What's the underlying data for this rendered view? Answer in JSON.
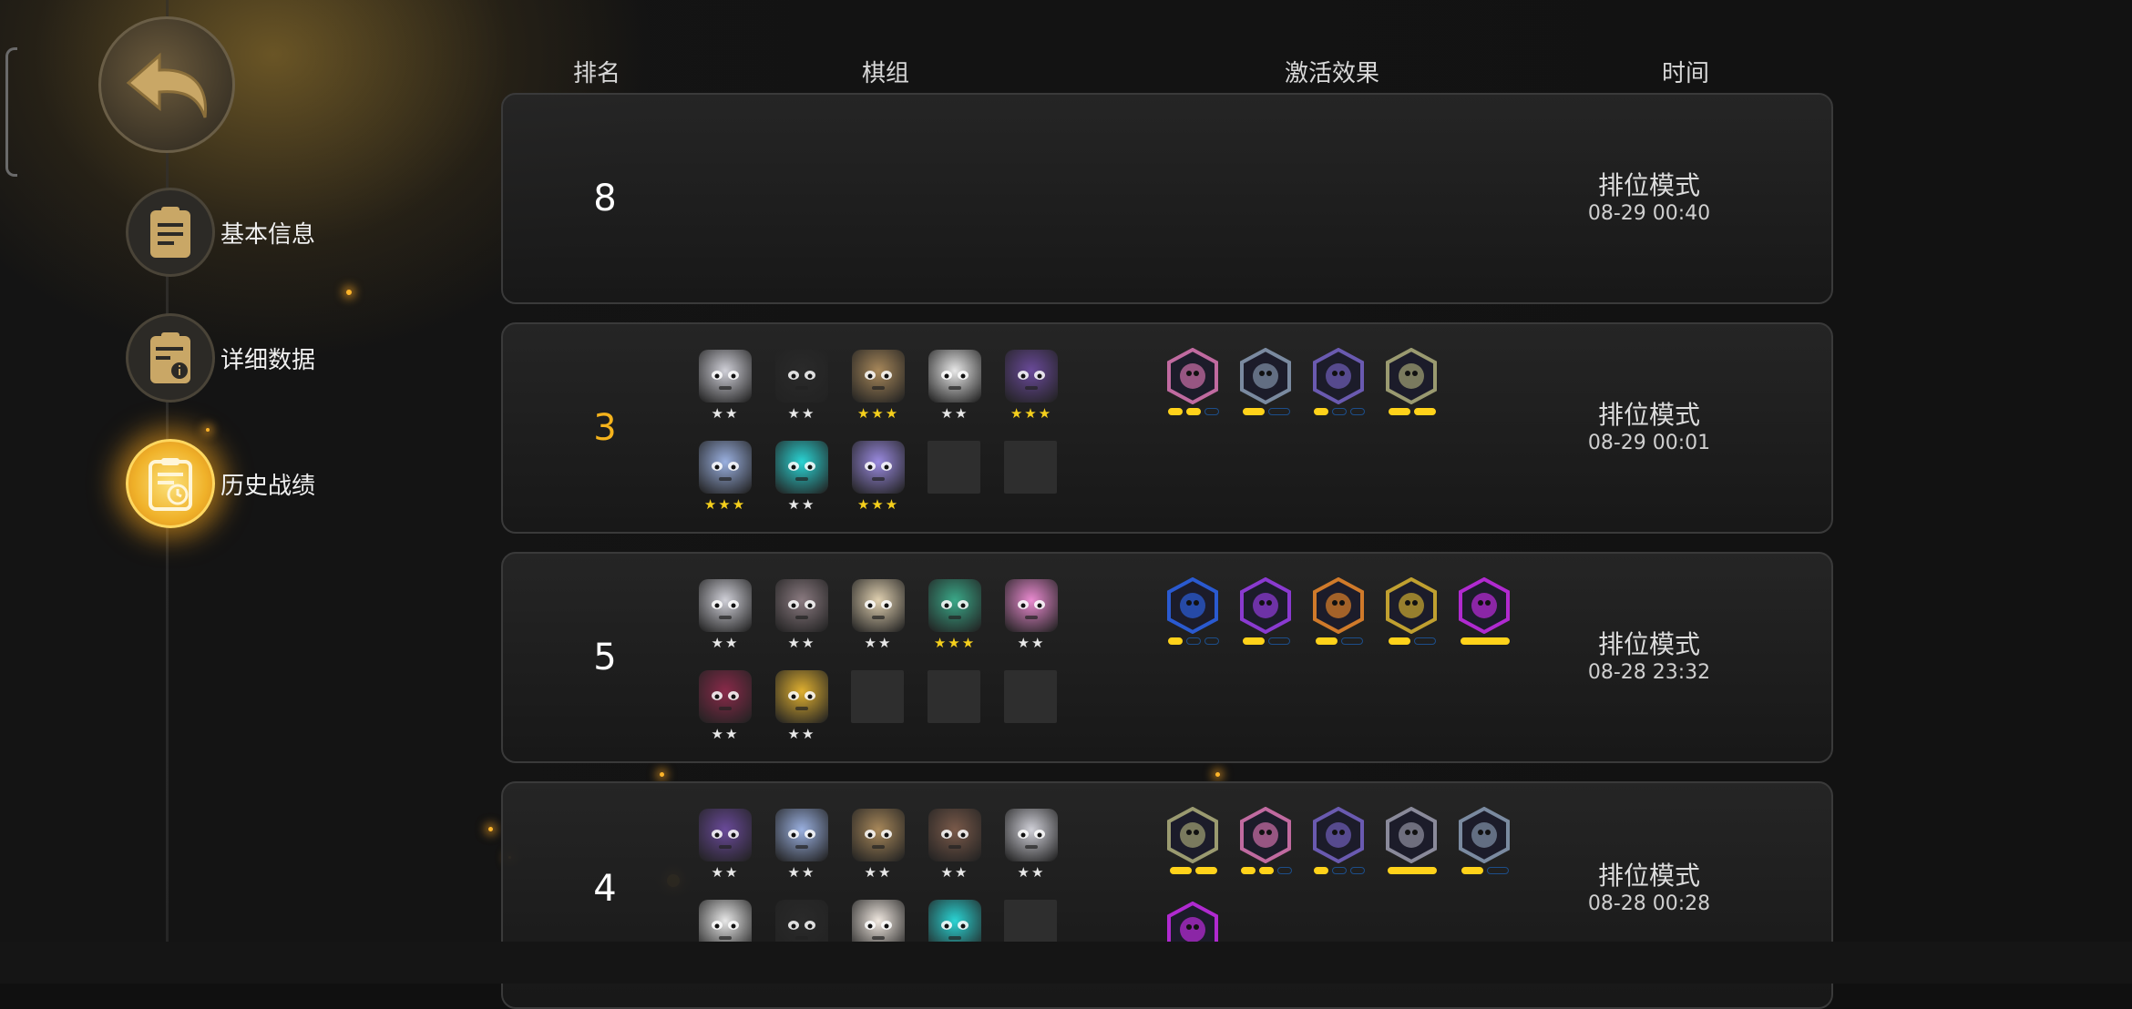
{
  "nav": {
    "back_label": "",
    "items": [
      {
        "label": "基本信息",
        "active": false
      },
      {
        "label": "详细数据",
        "active": false
      },
      {
        "label": "历史战绩",
        "active": true
      }
    ]
  },
  "headers": {
    "rank": "排名",
    "team": "棋组",
    "effects": "激活效果",
    "time": "时间"
  },
  "records": [
    {
      "rank": "8",
      "mode": "排位模式",
      "date": "08-29 00:40"
    },
    {
      "rank": "3",
      "mode": "排位模式",
      "date": "08-29 00:01"
    },
    {
      "rank": "5",
      "mode": "排位模式",
      "date": "08-28 23:32"
    },
    {
      "rank": "4",
      "mode": "排位模式",
      "date": "08-28 00:28"
    }
  ],
  "pieces": {
    "r1": [
      {
        "name": "knight-piece",
        "stars": "★★",
        "gold": false,
        "color": "#d0d0d8"
      },
      {
        "name": "hooded-piece",
        "stars": "★★",
        "gold": false,
        "color": "#2a2a2a"
      },
      {
        "name": "crate-piece",
        "stars": "★★★",
        "gold": true,
        "color": "#a8885a"
      },
      {
        "name": "ogre-piece",
        "stars": "★★",
        "gold": false,
        "color": "#e8e8e8"
      },
      {
        "name": "bat-piece",
        "stars": "★★★",
        "gold": true,
        "color": "#6a4a9a"
      },
      {
        "name": "robot-piece",
        "stars": "★★★",
        "gold": true,
        "color": "#9ab0e0"
      },
      {
        "name": "cyan-robot-piece",
        "stars": "★★",
        "gold": false,
        "color": "#2ad4d4"
      },
      {
        "name": "purple-mage-piece",
        "stars": "★★★",
        "gold": true,
        "color": "#9a8ae0"
      }
    ],
    "r2": [
      {
        "name": "knight-piece",
        "stars": "★★",
        "gold": false,
        "color": "#d0d0d8"
      },
      {
        "name": "grey-knight-piece",
        "stars": "★★",
        "gold": false,
        "color": "#8a7a80"
      },
      {
        "name": "cowboy-piece",
        "stars": "★★",
        "gold": false,
        "color": "#e0d0b0"
      },
      {
        "name": "green-dragon-piece",
        "stars": "★★★",
        "gold": true,
        "color": "#3aa888"
      },
      {
        "name": "pink-hat-piece",
        "stars": "★★",
        "gold": false,
        "color": "#ea8ad0"
      },
      {
        "name": "demon-piece",
        "stars": "★★",
        "gold": false,
        "color": "#8a2a4a"
      },
      {
        "name": "gold-hood-piece",
        "stars": "★★",
        "gold": false,
        "color": "#e0b030"
      }
    ],
    "r3": [
      {
        "name": "bat-piece",
        "stars": "★★",
        "gold": false,
        "color": "#6a4a9a"
      },
      {
        "name": "robot-piece",
        "stars": "★★",
        "gold": false,
        "color": "#9ab0e0"
      },
      {
        "name": "crate-piece",
        "stars": "★★",
        "gold": false,
        "color": "#a8885a"
      },
      {
        "name": "chest-piece",
        "stars": "★★",
        "gold": false,
        "color": "#7a5a4a"
      },
      {
        "name": "knight-piece",
        "stars": "★★",
        "gold": false,
        "color": "#d0d0d8"
      },
      {
        "name": "ogre-piece",
        "stars": "",
        "gold": false,
        "color": "#e8e8e8"
      },
      {
        "name": "hooded-piece",
        "stars": "",
        "gold": false,
        "color": "#2a2a2a"
      },
      {
        "name": "white-ogre-piece",
        "stars": "",
        "gold": false,
        "color": "#f0e8e0"
      },
      {
        "name": "cyan-robot-piece",
        "stars": "",
        "gold": false,
        "color": "#2ad4d4"
      }
    ]
  },
  "traits": {
    "r1": [
      {
        "name": "knight-trait-icon",
        "ring": "#c06aa0",
        "bars": [
          1,
          1,
          0
        ]
      },
      {
        "name": "swarm-trait-icon",
        "ring": "#7a8aa0",
        "bars": [
          1,
          0
        ]
      },
      {
        "name": "tech-trait-icon",
        "ring": "#6a5ab0",
        "bars": [
          1,
          0,
          0
        ]
      },
      {
        "name": "beast-trait-icon",
        "ring": "#9a9a70",
        "bars": [
          1,
          1
        ]
      }
    ],
    "r2": [
      {
        "name": "blue-feather-trait-icon",
        "ring": "#2a5ad0",
        "bars": [
          1,
          0,
          0
        ]
      },
      {
        "name": "purple-knight-trait-icon",
        "ring": "#8a3ad0",
        "bars": [
          1,
          0
        ]
      },
      {
        "name": "orange-leaf-trait-icon",
        "ring": "#d07a2a",
        "bars": [
          1,
          0
        ]
      },
      {
        "name": "gold-blade-trait-icon",
        "ring": "#c0a030",
        "bars": [
          1,
          0
        ]
      },
      {
        "name": "demon-skull-trait-icon",
        "ring": "#b02ad0",
        "bars": [
          1
        ]
      }
    ],
    "r3": [
      {
        "name": "beast-trait-icon",
        "ring": "#9a9a70",
        "bars": [
          1,
          1
        ]
      },
      {
        "name": "knight-trait-icon",
        "ring": "#c06aa0",
        "bars": [
          1,
          1,
          0
        ]
      },
      {
        "name": "tech-trait-icon",
        "ring": "#6a5ab0",
        "bars": [
          1,
          0,
          0
        ]
      },
      {
        "name": "cross-trait-icon",
        "ring": "#8a8a9a",
        "bars": [
          1
        ]
      },
      {
        "name": "swarm-trait-icon",
        "ring": "#7a8aa0",
        "bars": [
          1,
          0
        ]
      },
      {
        "name": "demon-skull-trait-icon",
        "ring": "#b02ad0",
        "bars": []
      }
    ]
  }
}
